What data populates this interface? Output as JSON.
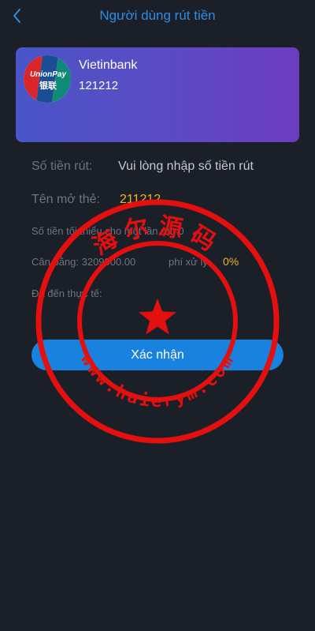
{
  "header": {
    "title": "Người dùng rút tiền",
    "back_icon": "chevron-left-icon",
    "accent_color": "#2f8de4"
  },
  "card": {
    "bank_name": "Vietinbank",
    "account_number": "121212",
    "logo": {
      "name": "unionpay-logo",
      "text_top": "UnionPay",
      "text_bottom": "银联"
    }
  },
  "form": {
    "amount_label": "Số tiền rút:",
    "amount_placeholder": "Vui lòng nhập số tiền rút",
    "holder_label": "Tên mở thẻ:",
    "holder_value": "211212",
    "min_text": "Số tiền tối thiểu cho một lần rút: 0",
    "balance_text": "Cân bằng: 3209900.00",
    "fee_label": "phí xử lý:",
    "fee_value": "0%",
    "actual_label": "Đã đến thực tế:"
  },
  "submit_label": "Xác nhận",
  "watermark": {
    "top_text": "海尔源码",
    "bottom_text": "www.haierym.com",
    "color": "#e41010"
  }
}
